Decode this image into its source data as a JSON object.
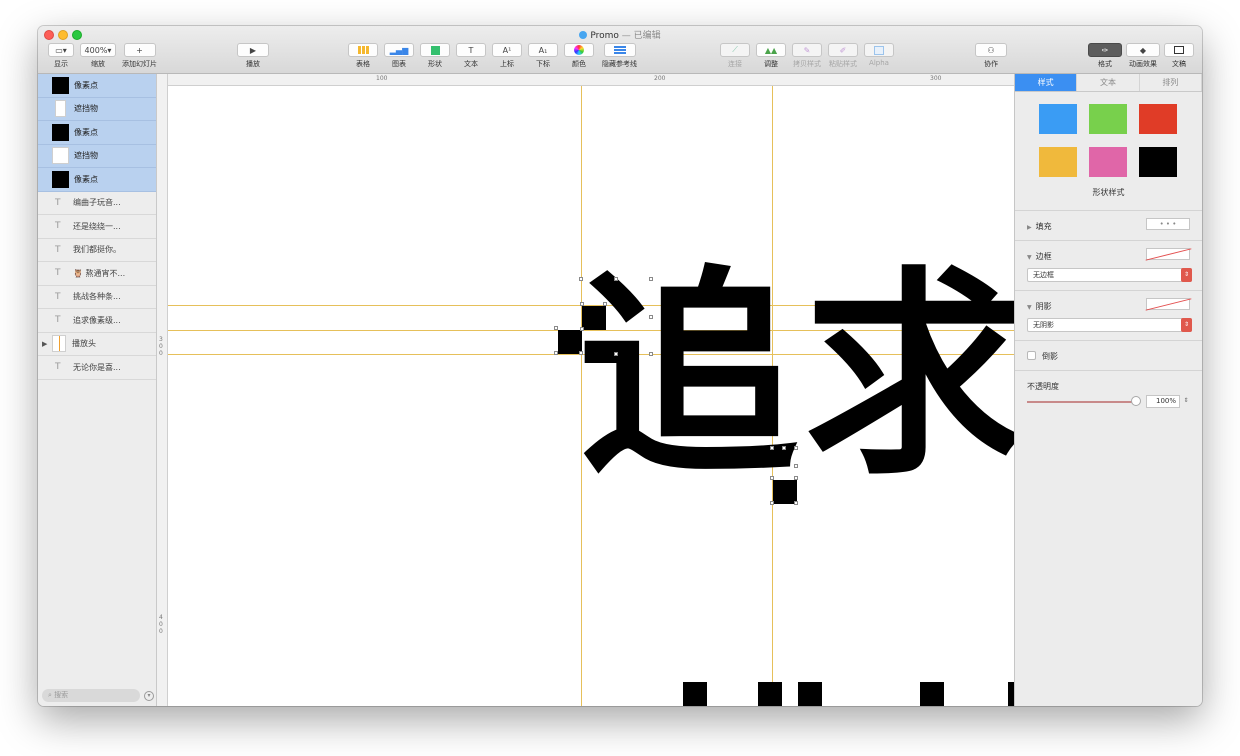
{
  "window": {
    "title": "Promo",
    "title_sep": " — ",
    "status": "已编辑"
  },
  "toolbar": {
    "view": {
      "label": "显示"
    },
    "zoom": {
      "value": "400%",
      "label": "缩放"
    },
    "add_slide": {
      "label": "添加幻灯片"
    },
    "play": {
      "label": "播放"
    },
    "table": {
      "label": "表格"
    },
    "chart": {
      "label": "图表"
    },
    "shape": {
      "label": "形状"
    },
    "text": {
      "label": "文本"
    },
    "superscript": {
      "label": "上标",
      "glyph": "A¹"
    },
    "subscript": {
      "label": "下标",
      "glyph": "A₁"
    },
    "color": {
      "label": "颜色"
    },
    "hide_guides": {
      "label": "隐藏参考线"
    },
    "connect": {
      "label": "连接"
    },
    "adjust": {
      "label": "调整"
    },
    "copy_style": {
      "label": "拷贝样式"
    },
    "paste_style": {
      "label": "粘贴样式"
    },
    "alpha": {
      "label": "Alpha"
    },
    "collaborate": {
      "label": "协作"
    },
    "format": {
      "label": "格式"
    },
    "animate": {
      "label": "动画效果"
    },
    "document": {
      "label": "文稿"
    }
  },
  "ruler": {
    "h_ticks": [
      "100",
      "200",
      "300"
    ],
    "v_ticks": [
      "3 0 0",
      "4 0 0"
    ]
  },
  "layers": [
    {
      "name": "像素点",
      "kind": "black",
      "selected": true
    },
    {
      "name": "遮挡物",
      "kind": "white-narrow",
      "selected": true
    },
    {
      "name": "像素点",
      "kind": "black",
      "selected": true
    },
    {
      "name": "遮挡物",
      "kind": "white",
      "selected": true
    },
    {
      "name": "像素点",
      "kind": "black",
      "selected": true
    },
    {
      "name": "编曲子玩音...",
      "kind": "text",
      "selected": false
    },
    {
      "name": "还是绕绕一...",
      "kind": "text",
      "selected": false
    },
    {
      "name": "我们都挺你。",
      "kind": "text",
      "selected": false
    },
    {
      "name": "🦉 熬通宵不...",
      "kind": "text",
      "selected": false
    },
    {
      "name": "挑战各种条...",
      "kind": "text",
      "selected": false
    },
    {
      "name": "追求像素级...",
      "kind": "text",
      "selected": false
    },
    {
      "name": "播放头",
      "kind": "playhead",
      "selected": false
    },
    {
      "name": "无论你是喜...",
      "kind": "text",
      "selected": false
    }
  ],
  "search": {
    "placeholder": "搜索"
  },
  "canvas": {
    "chars": [
      "追",
      "求"
    ]
  },
  "inspector": {
    "tabs": [
      "样式",
      "文本",
      "排列"
    ],
    "active_tab": "样式",
    "swatch_colors": [
      "#3a9cf4",
      "#78d04c",
      "#e03c27",
      "#f0b93c",
      "#e066a8",
      "#000000"
    ],
    "swatch_title": "形状样式",
    "fill_label": "填充",
    "border_label": "边框",
    "border_value": "无边框",
    "shadow_label": "阴影",
    "shadow_value": "无阴影",
    "reflection_label": "倒影",
    "opacity_label": "不透明度",
    "opacity_value": "100%"
  },
  "colors": {
    "guide": "#e6c05a",
    "selection": "#b9d1ef",
    "active_tab": "#3b8ff2"
  }
}
